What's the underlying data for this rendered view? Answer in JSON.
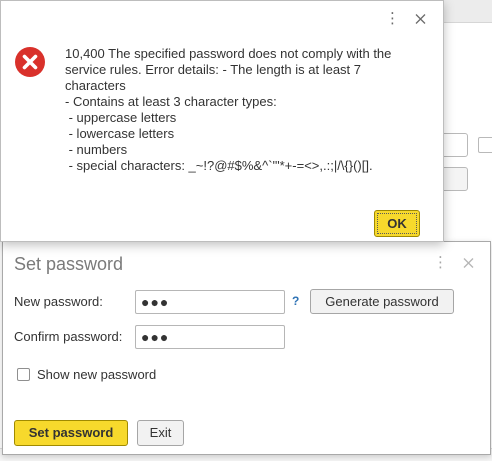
{
  "error_dialog": {
    "message_lines": [
      "10,400 The specified password does not comply with the",
      "service rules. Error details: - The length is at least 7",
      "characters",
      "- Contains at least 3 character types:",
      " - uppercase letters",
      " - lowercase letters",
      " - numbers",
      " - special characters: _~!?@#$%&^`'\"*+-=<>,.:;|/\\{}()[]."
    ],
    "ok_label": "OK",
    "icon": "error-icon",
    "colors": {
      "error_red": "#d9312b",
      "ok_yellow": "#f7d92c"
    }
  },
  "password_dialog": {
    "title": "Set password",
    "new_password_label": "New password:",
    "new_password_value": "●●●",
    "help_mark": "?",
    "generate_label": "Generate password",
    "confirm_password_label": "Confirm password:",
    "confirm_password_value": "●●●",
    "show_password_label": "Show new password",
    "show_password_checked": false,
    "set_password_label": "Set password",
    "exit_label": "Exit",
    "colors": {
      "primary_button": "#f7d92c",
      "help_link": "#2f73b5"
    }
  }
}
